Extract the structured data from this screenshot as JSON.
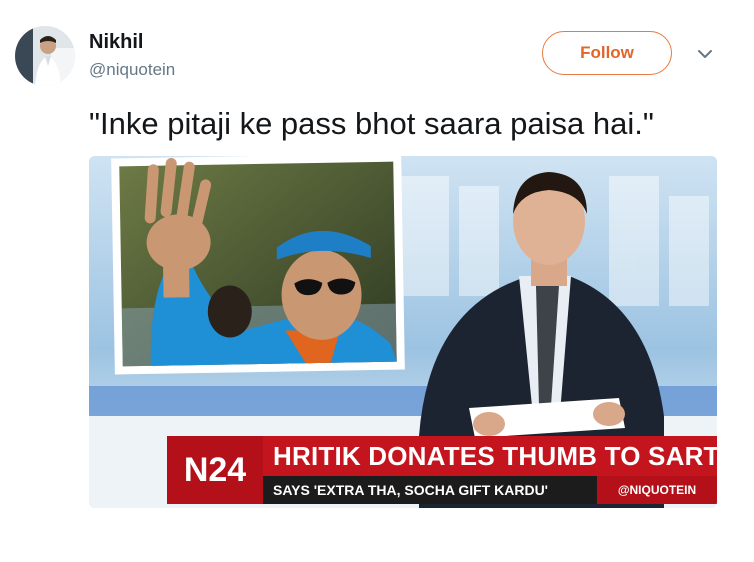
{
  "user": {
    "display_name": "Nikhil",
    "handle": "@niquotein"
  },
  "follow_label": "Follow",
  "tweet": {
    "text": "\"Inke pitaji ke pass bhot saara paisa hai.\""
  },
  "news_graphic": {
    "channel": "N24",
    "headline": "HRITIK DONATES THUMB TO SARTAJ",
    "subline": "SAYS 'EXTRA THA, SOCHA GIFT KARDU'",
    "credit": "@NIQUOTEIN"
  },
  "colors": {
    "follow_accent": "#e8793f",
    "ticker_red": "#c4141d",
    "ticker_dark": "#1c1c1c",
    "handle_gray": "#657786"
  },
  "icons": {
    "caret": "chevron-down-icon"
  }
}
